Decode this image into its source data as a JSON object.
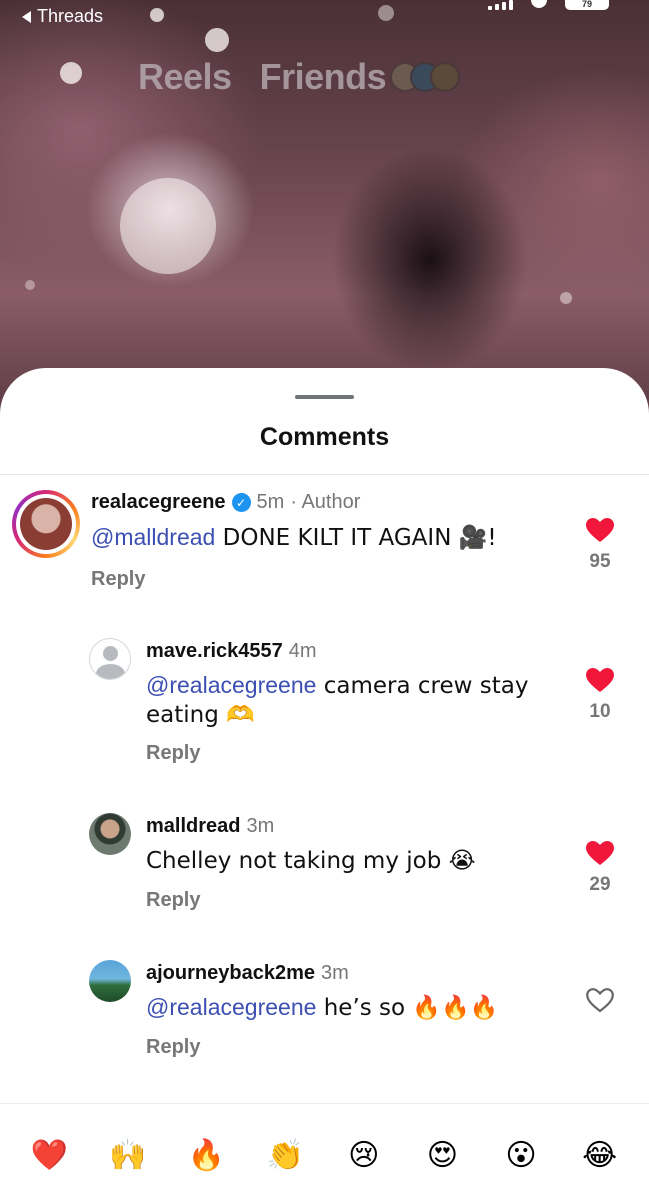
{
  "status_bar": {
    "back_label": "Threads",
    "battery": "79"
  },
  "feed_tabs": [
    "Reels",
    "Friends"
  ],
  "sheet": {
    "title": "Comments"
  },
  "comments": [
    {
      "username": "realacegreene",
      "verified": true,
      "time": "5m",
      "badge": "· Author",
      "mention": "@malldread",
      "text": " DONE KILT IT AGAIN 🎥!",
      "reply_label": "Reply",
      "liked": true,
      "likes": "95",
      "avatar_color": "#8a3d33"
    },
    {
      "username": "mave.rick4557",
      "verified": false,
      "time": "4m",
      "mention": "@realacegreene",
      "text": " camera crew stay eating 🫶",
      "reply_label": "Reply",
      "liked": true,
      "likes": "10",
      "avatar_color": "#c4c6ca"
    },
    {
      "username": "malldread",
      "verified": false,
      "time": "3m",
      "mention": "",
      "text": "Chelley not taking my job 😭",
      "reply_label": "Reply",
      "liked": true,
      "likes": "29",
      "avatar_color": "#5a5e63"
    },
    {
      "username": "ajourneyback2me",
      "verified": false,
      "time": "3m",
      "mention": "@realacegreene",
      "text": " he’s so 🔥🔥🔥",
      "reply_label": "Reply",
      "liked": false,
      "likes": "",
      "avatar_color": "#3d7fa8"
    }
  ],
  "quick_reactions": [
    "❤️",
    "🙌",
    "🔥",
    "👏",
    "😢",
    "😍",
    "😮",
    "😂"
  ],
  "colors": {
    "heart": "#f0173a",
    "mention": "#3c4fb3",
    "verified": "#1d95f0"
  }
}
